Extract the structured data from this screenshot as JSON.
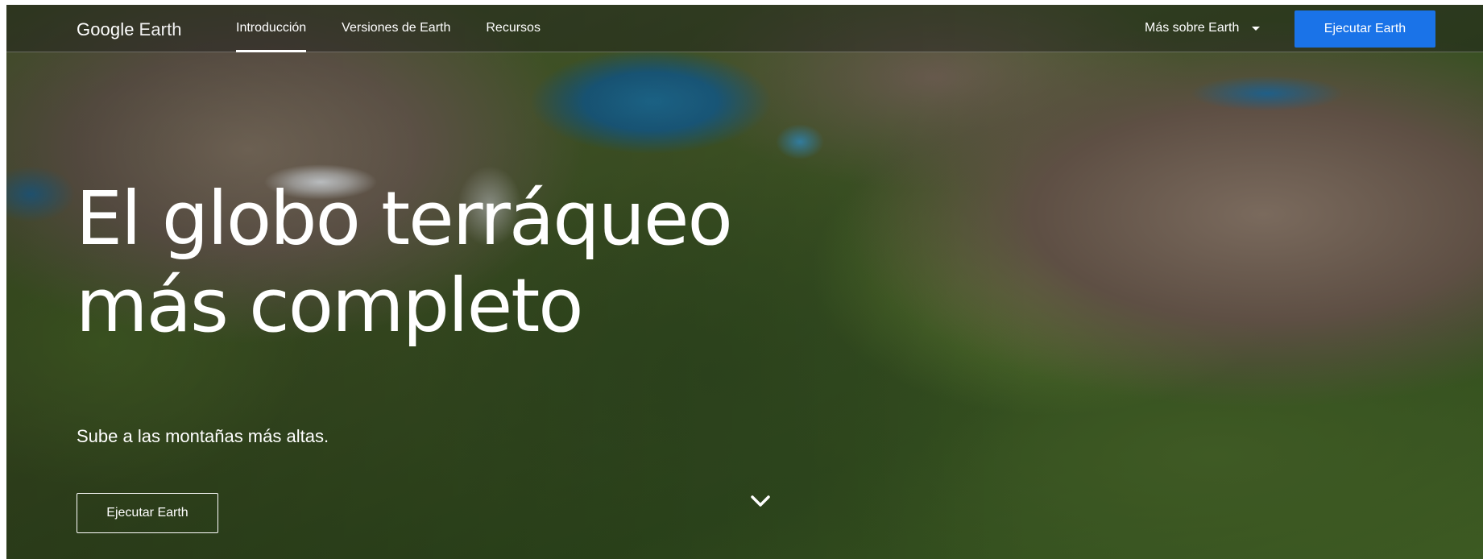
{
  "header": {
    "logo_google": "Google",
    "logo_product": "Earth",
    "nav": [
      {
        "label": "Introducción",
        "active": true
      },
      {
        "label": "Versiones de Earth",
        "active": false
      },
      {
        "label": "Recursos",
        "active": false
      }
    ],
    "more_menu_label": "Más sobre Earth",
    "cta_label": "Ejecutar Earth"
  },
  "hero": {
    "title_line1": "El globo terráqueo",
    "title_line2": "más completo",
    "subtitle": "Sube a las montañas más altas.",
    "cta_label": "Ejecutar Earth"
  },
  "icons": {
    "more_menu": "caret-down-icon",
    "scroll": "chevron-down-icon"
  },
  "colors": {
    "primary_button": "#1a73e8",
    "text": "#ffffff"
  }
}
